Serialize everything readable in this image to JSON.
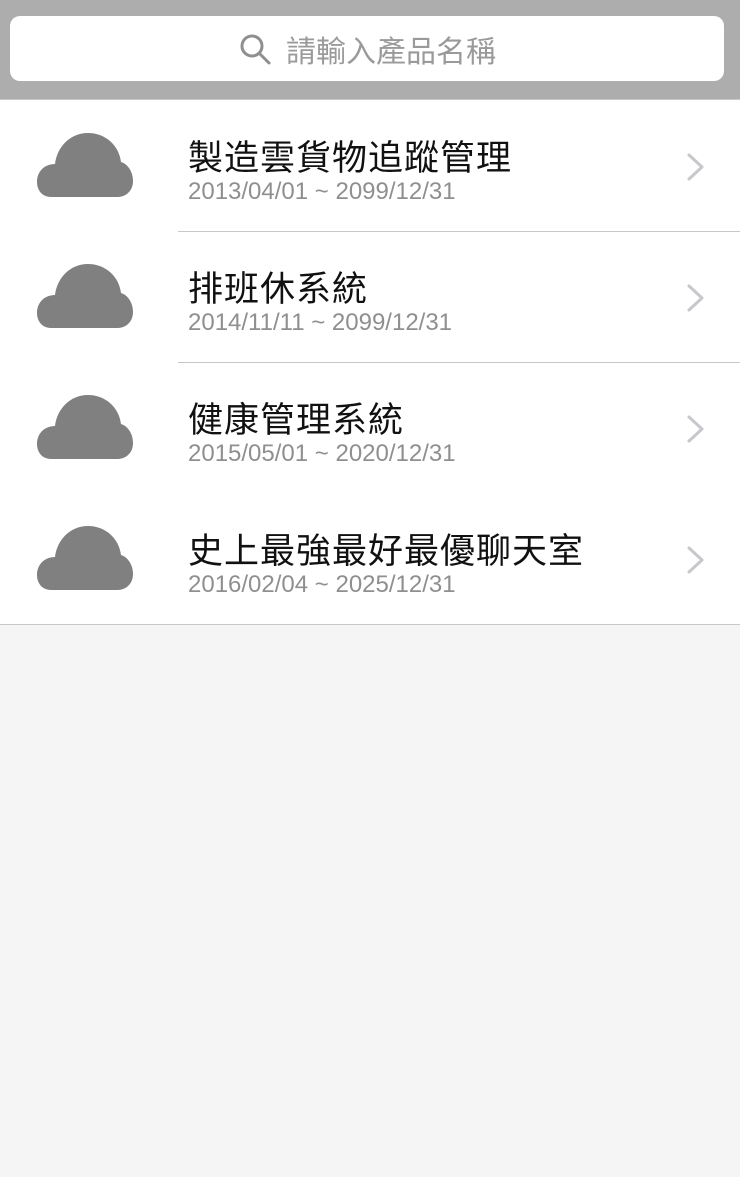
{
  "search": {
    "placeholder": "請輸入產品名稱",
    "icon": "search-icon"
  },
  "colors": {
    "search_bar_bg": "#adadad",
    "list_bg": "#ffffff",
    "page_bg": "#f5f5f5",
    "cloud_icon": "#808080",
    "title_text": "#111111",
    "date_text": "#8f8f8f",
    "chevron": "#c7c7cc",
    "separator": "#c8c8c8"
  },
  "products": [
    {
      "icon": "cloud-icon",
      "title": "製造雲貨物追蹤管理",
      "date_range": "2013/04/01 ~ 2099/12/31"
    },
    {
      "icon": "cloud-icon",
      "title": "排班休系統",
      "date_range": "2014/11/11 ~ 2099/12/31"
    },
    {
      "icon": "cloud-icon",
      "title": "健康管理系統",
      "date_range": "2015/05/01 ~ 2020/12/31"
    },
    {
      "icon": "cloud-icon",
      "title": "史上最強最好最優聊天室",
      "date_range": "2016/02/04 ~ 2025/12/31"
    }
  ]
}
